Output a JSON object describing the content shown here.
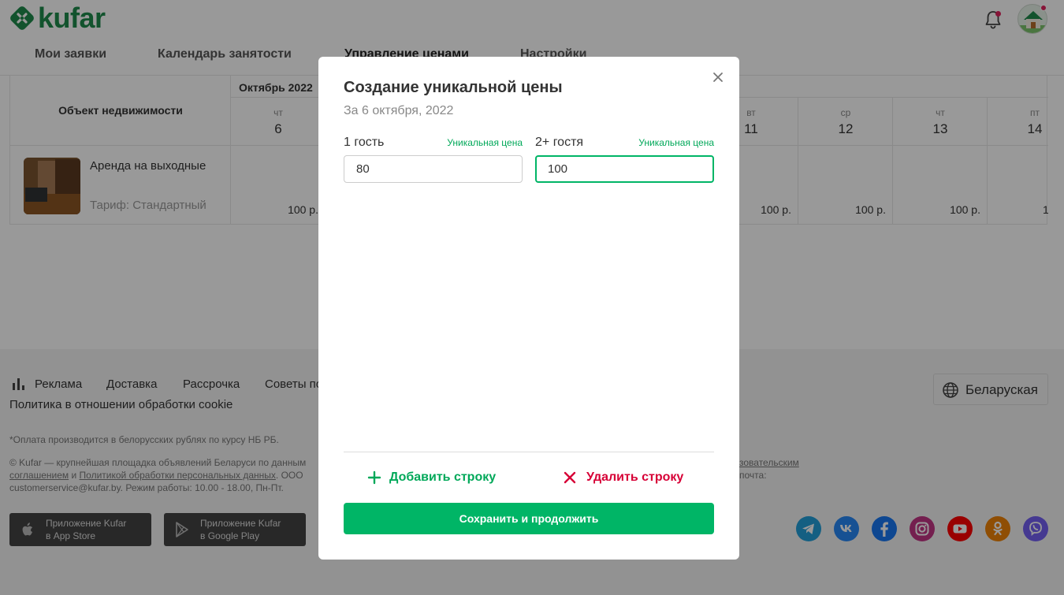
{
  "header": {
    "logo_text": "kufar",
    "tabs": [
      {
        "label": "Мои заявки"
      },
      {
        "label": "Календарь занятости"
      },
      {
        "label": "Управление ценами"
      },
      {
        "label": "Настройки"
      }
    ],
    "notification_icon": "bell-icon",
    "avatar_icon": "house-avatar"
  },
  "table": {
    "object_header": "Объект недвижимости",
    "month_label": "Октябрь 2022",
    "listing": {
      "title": "Аренда на выходные",
      "tariff": "Тариф: Стандартный"
    },
    "days": [
      {
        "dow": "чт",
        "num": "6",
        "price": "100 р."
      },
      {
        "dow": "вт",
        "num": "11",
        "price": "100 р."
      },
      {
        "dow": "ср",
        "num": "12",
        "price": "100 р."
      },
      {
        "dow": "чт",
        "num": "13",
        "price": "100 р."
      },
      {
        "dow": "пт",
        "num": "14",
        "price": "1"
      }
    ]
  },
  "footer": {
    "nav": [
      "Реклама",
      "Доставка",
      "Рассрочка",
      "Советы по"
    ],
    "cookie_link": "Политика в отношении обработки cookie",
    "note": "*Оплата производится в белорусских рублях по курсу НБ РБ.",
    "legal": {
      "prefix": "© Kufar — крупнейшая площадка объявлений Беларуси по данным",
      "agreement": "соглашением",
      "and": "и",
      "policy": "Политикой обработки персональных данных",
      "suffix": ". ООО",
      "contact": "customerservice@kufar.by. Режим работы: 10.00 - 18.00, Пн-Пт.",
      "right_line1": "зовательским",
      "right_line2": "почта:"
    },
    "app_store": {
      "line1": "Приложение Kufar",
      "line2": "в App Store"
    },
    "google_play": {
      "line1": "Приложение Kufar",
      "line2": "в Google Play"
    },
    "language": "Беларуская",
    "socials": [
      {
        "name": "telegram-icon",
        "color": "#229ed9"
      },
      {
        "name": "vk-icon",
        "color": "#2787f5"
      },
      {
        "name": "facebook-icon",
        "color": "#1877f2"
      },
      {
        "name": "instagram-icon",
        "color": "#c13584"
      },
      {
        "name": "youtube-icon",
        "color": "#ff0000"
      },
      {
        "name": "odnoklassniki-icon",
        "color": "#ee8208"
      },
      {
        "name": "viber-icon",
        "color": "#7360f2"
      }
    ]
  },
  "modal": {
    "title": "Создание уникальной цены",
    "subtitle": "За 6 октября, 2022",
    "fields": [
      {
        "label": "1 гость",
        "hint": "Уникальная цена",
        "value": "80"
      },
      {
        "label": "2+ гостя",
        "hint": "Уникальная цена",
        "value": "100"
      }
    ],
    "add_row": "Добавить строку",
    "delete_row": "Удалить строку",
    "save": "Сохранить и продолжить"
  },
  "colors": {
    "brand_green": "#00b566",
    "danger_red": "#d70036",
    "hint_green": "#00a859"
  }
}
